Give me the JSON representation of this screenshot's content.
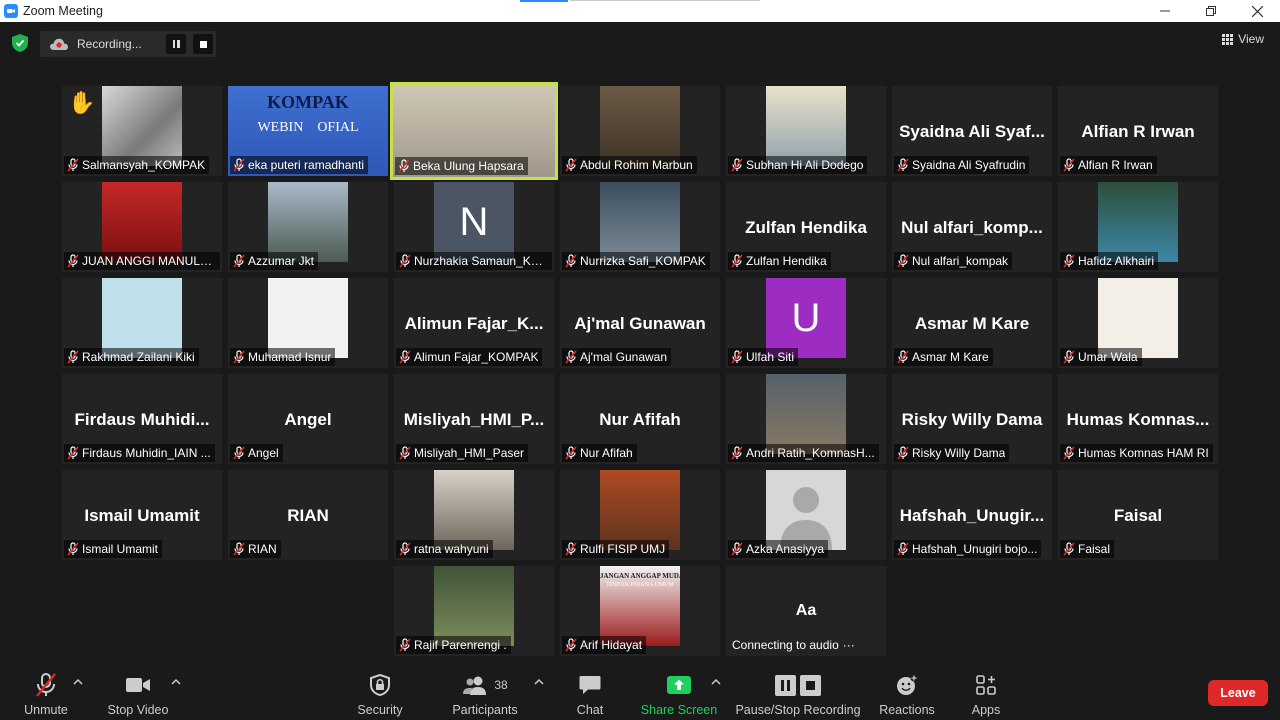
{
  "window": {
    "title": "Zoom Meeting",
    "controls": [
      "minimize-icon",
      "restore-icon",
      "close-icon"
    ]
  },
  "top": {
    "recording_label": "Recording...",
    "view_label": "View"
  },
  "colors": {
    "active_speaker": "#c6e04a",
    "leave": "#e02828",
    "share_green": "#20d05e",
    "muted_red": "#e02828"
  },
  "tiles": [
    {
      "name": "Salmansyah_KOMPAK",
      "video": "photo",
      "hand": true
    },
    {
      "name": "eka puteri ramadhanti",
      "video": "photo",
      "photo_text": "KOMPAK",
      "photo_text2": "WEBIN    OFIAL"
    },
    {
      "name": "Beka Ulung Hapsara",
      "video": "photo",
      "active": true
    },
    {
      "name": "Abdul Rohim Marbun",
      "video": "photo"
    },
    {
      "name": "Subhan Hi Ali Dodego",
      "video": "photo"
    },
    {
      "name": "Syaidna Ali Syafrudin",
      "big": "Syaidna  Ali  Syaf..."
    },
    {
      "name": "Alfian R Irwan",
      "big": "Alfian R Irwan"
    },
    {
      "name": "JUAN ANGGI MANULL...",
      "video": "photo"
    },
    {
      "name": "Azzumar Jkt",
      "video": "photo"
    },
    {
      "name": "Nurzhakia Samaun_KO...",
      "letter": "N"
    },
    {
      "name": "Nurrizka Safi_KOMPAK",
      "video": "photo"
    },
    {
      "name": "Zulfan Hendika",
      "big": "Zulfan Hendika"
    },
    {
      "name": "Nul alfari_kompak",
      "big": "Nul  alfari_komp..."
    },
    {
      "name": "Hafidz Alkhairi",
      "video": "photo"
    },
    {
      "name": "Rakhmad Zailani Kiki",
      "video": "photo"
    },
    {
      "name": "Muhamad Isnur",
      "video": "photo"
    },
    {
      "name": "Alimun Fajar_KOMPAK",
      "big": "Alimun  Fajar_K..."
    },
    {
      "name": "Aj'mal Gunawan",
      "big": "Aj'mal Gunawan"
    },
    {
      "name": "Ulfah Siti",
      "letter": "U"
    },
    {
      "name": "Asmar M Kare",
      "big": "Asmar M Kare"
    },
    {
      "name": "Umar Wala",
      "video": "photo"
    },
    {
      "name": "Firdaus Muhidin_IAIN ...",
      "big": "Firdaus  Muhidi..."
    },
    {
      "name": "Angel",
      "big": "Angel"
    },
    {
      "name": "Misliyah_HMI_Paser",
      "big": "Misliyah_HMI_P..."
    },
    {
      "name": "Nur Afifah",
      "big": "Nur Afifah"
    },
    {
      "name": "Andri Ratih_KomnasH...",
      "video": "photo"
    },
    {
      "name": "Risky Willy Dama",
      "big": "Risky Willy Dama"
    },
    {
      "name": "Humas Komnas HAM RI",
      "big": "Humas  Komnas..."
    },
    {
      "name": "Ismail Umamit",
      "big": "Ismail Umamit"
    },
    {
      "name": "RIAN",
      "big": "RIAN"
    },
    {
      "name": "ratna wahyuni",
      "video": "photo"
    },
    {
      "name": "Rulfi FISIP UMJ",
      "video": "photo"
    },
    {
      "name": "Azka Anasiyya",
      "video": "avatar"
    },
    {
      "name": "Hafshah_Unugiri bojo...",
      "big": "Hafshah_Unugir..."
    },
    {
      "name": "Faisal",
      "big": "Faisal"
    },
    {
      "name": "Rajif Parenrengi .",
      "video": "photo"
    },
    {
      "name": "Arif Hidayat",
      "video": "photo",
      "photo_text": "JANGAN ANGGAP MUDA",
      "photo_text2": "TINDAK PIDANA UMUM"
    },
    {
      "name": "Connecting to audio",
      "big_aa": "Aa",
      "connecting": true
    }
  ],
  "toolbar": {
    "unmute": "Unmute",
    "stop_video": "Stop Video",
    "security": "Security",
    "participants": "Participants",
    "participants_count": "38",
    "chat": "Chat",
    "share_screen": "Share Screen",
    "pause_stop_recording": "Pause/Stop Recording",
    "reactions": "Reactions",
    "apps": "Apps",
    "leave": "Leave"
  }
}
